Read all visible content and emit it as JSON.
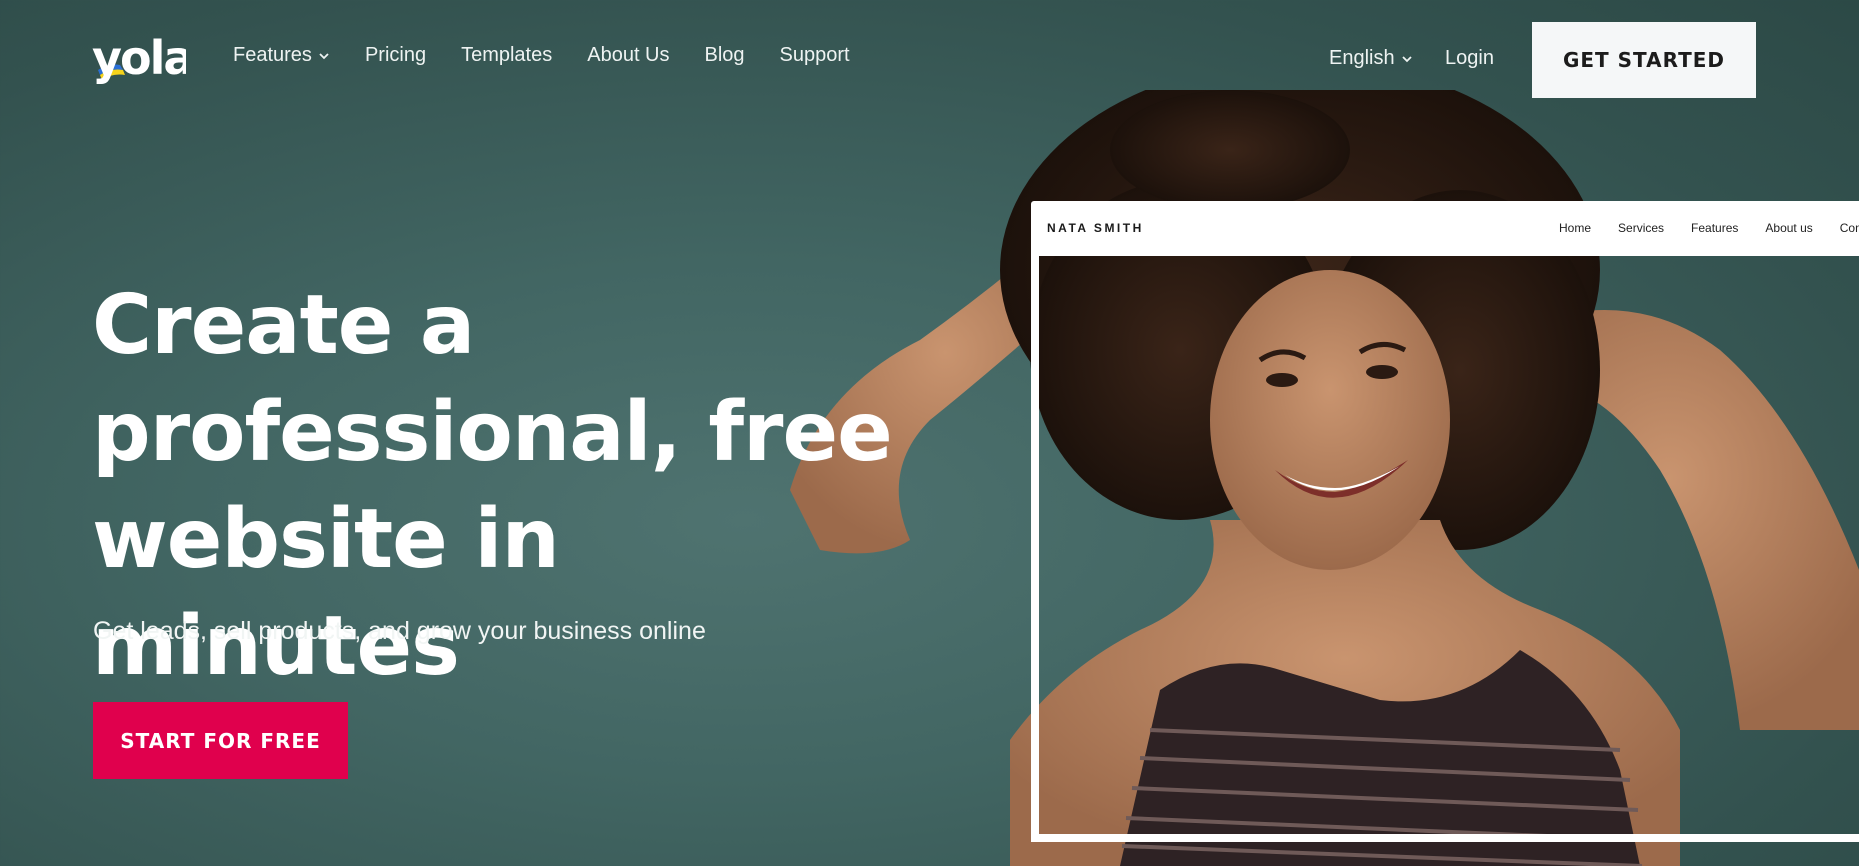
{
  "brand": {
    "logo_text": "yola"
  },
  "nav": {
    "items": [
      {
        "label": "Features",
        "has_dropdown": true
      },
      {
        "label": "Pricing",
        "has_dropdown": false
      },
      {
        "label": "Templates",
        "has_dropdown": false
      },
      {
        "label": "About Us",
        "has_dropdown": false
      },
      {
        "label": "Blog",
        "has_dropdown": false
      },
      {
        "label": "Support",
        "has_dropdown": false
      }
    ],
    "language": "English",
    "login": "Login",
    "get_started": "GET STARTED"
  },
  "hero": {
    "title_line1": "Create a",
    "title_line2": "professional, free",
    "title_line3": "website in minutes",
    "subtitle": "Get leads, sell products, and grow your business online",
    "cta": "START FOR FREE"
  },
  "mockup": {
    "brand": "NATA SMITH",
    "nav": [
      "Home",
      "Services",
      "Features",
      "About us",
      "Cont"
    ]
  },
  "colors": {
    "background": "#426663",
    "cta": "#e0004d",
    "get_started_bg": "#f5f7f8",
    "logo_flag_blue": "#2a6fd6",
    "logo_flag_yellow": "#f6d31b"
  }
}
